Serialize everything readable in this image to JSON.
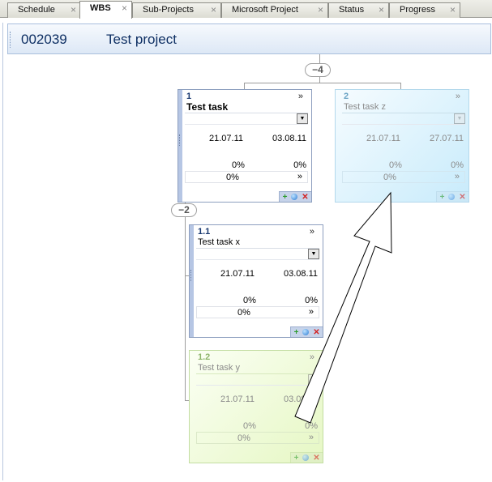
{
  "tabs": [
    {
      "label": "Schedule",
      "active": false
    },
    {
      "label": "WBS",
      "active": true
    },
    {
      "label": "Sub-Projects",
      "active": false
    },
    {
      "label": "Microsoft Project",
      "active": false
    },
    {
      "label": "Status",
      "active": false
    },
    {
      "label": "Progress",
      "active": false
    }
  ],
  "tab_close_glyph": "×",
  "header": {
    "code": "002039",
    "title": "Test project"
  },
  "collapse": {
    "root": "−4",
    "task1": "−2"
  },
  "cards": {
    "t1": {
      "num": "1",
      "name": "Test task",
      "start": "21.07.11",
      "end": "03.08.11",
      "pct1": "0%",
      "pct2": "0%",
      "ctrl_value": "0%",
      "expand": "»",
      "ctrl_arrow": "»"
    },
    "t2": {
      "num": "2",
      "name": "Test task z",
      "start": "21.07.11",
      "end": "27.07.11",
      "pct1": "0%",
      "pct2": "0%",
      "ctrl_value": "0%",
      "expand": "»",
      "ctrl_arrow": "»"
    },
    "t11": {
      "num": "1.1",
      "name": "Test task x",
      "start": "21.07.11",
      "end": "03.08.11",
      "pct1": "0%",
      "pct2": "0%",
      "ctrl_value": "0%",
      "expand": "»",
      "ctrl_arrow": "»"
    },
    "t12": {
      "num": "1.2",
      "name": "Test task y",
      "start": "21.07.11",
      "end": "03.08.11",
      "pct1": "0%",
      "pct2": "0%",
      "ctrl_value": "0%",
      "expand": "»",
      "ctrl_arrow": "»"
    }
  },
  "icons": {
    "add": "add-icon",
    "info": "info-icon",
    "delete": "delete-icon",
    "dropdown": "dropdown-arrow-icon"
  },
  "colors": {
    "header_text": "#0e2f63",
    "card_accent": "#b6c6e4",
    "drag_ghost_blue": "#c8ebfb",
    "drag_ghost_green": "#e6f7c4"
  }
}
